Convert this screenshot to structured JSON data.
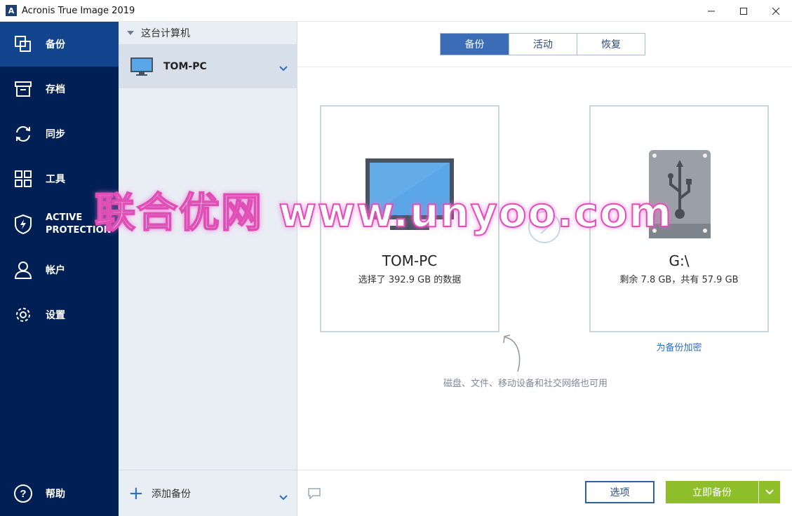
{
  "window": {
    "title": "Acronis True Image 2019",
    "logo_letter": "A"
  },
  "nav": {
    "items": [
      {
        "label": "备份",
        "icon": "copy-icon",
        "active": true
      },
      {
        "label": "存档",
        "icon": "archive-icon"
      },
      {
        "label": "同步",
        "icon": "sync-icon"
      },
      {
        "label": "工具",
        "icon": "grid-icon"
      },
      {
        "label_line1": "ACTIVE",
        "label_line2": "PROTECTION",
        "icon": "shield-icon"
      },
      {
        "label": "帐户",
        "icon": "user-icon"
      },
      {
        "label": "设置",
        "icon": "gear-icon"
      }
    ],
    "help_label": "帮助"
  },
  "sources": {
    "group_label": "这台计算机",
    "item_label": "TOM-PC",
    "add_label": "添加备份"
  },
  "tabs": [
    "备份",
    "活动",
    "恢复"
  ],
  "source_card": {
    "title": "TOM-PC",
    "subtitle": "选择了 392.9 GB 的数据"
  },
  "dest_card": {
    "title": "G:\\",
    "subtitle": "剩余 7.8 GB，共有 57.9 GB"
  },
  "encrypt_link": "为备份加密",
  "hint": "磁盘、文件、移动设备和社交网络也可用",
  "buttons": {
    "options": "选项",
    "backup_now": "立即备份"
  },
  "watermark": "联合优网 www.unyoo.com",
  "colors": {
    "nav_bg": "#002055",
    "nav_active": "#11468f",
    "accent_blue": "#3b6db7",
    "go_green": "#8ebf2a"
  }
}
